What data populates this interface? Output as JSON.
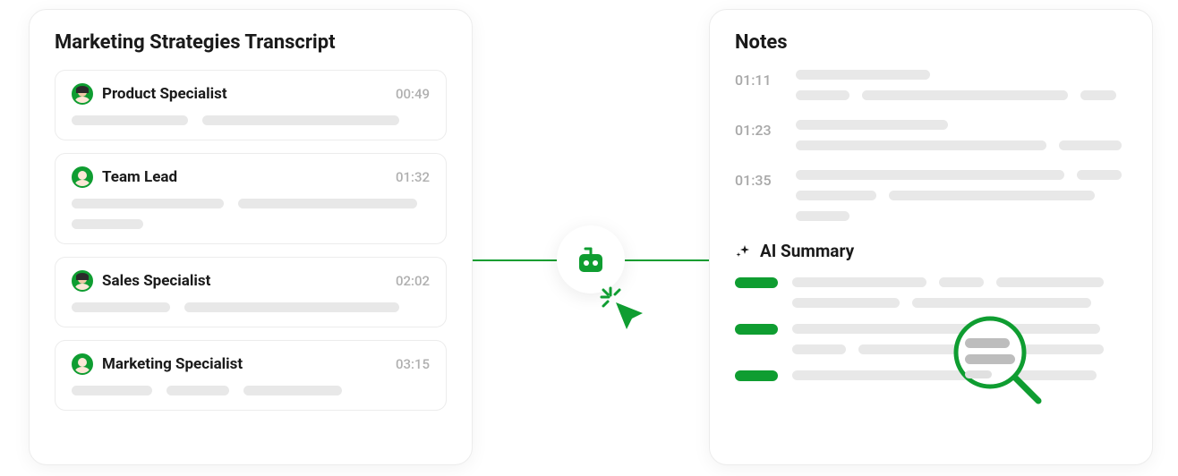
{
  "colors": {
    "accent": "#0f9d31",
    "skeleton": "#e8e8e8",
    "text_muted": "#a8a8a8"
  },
  "transcript": {
    "title": "Marketing Strategies Transcript",
    "entries": [
      {
        "role": "Product Specialist",
        "time": "00:49",
        "avatar_variant": "dark"
      },
      {
        "role": "Team Lead",
        "time": "01:32",
        "avatar_variant": "light"
      },
      {
        "role": "Sales Specialist",
        "time": "02:02",
        "avatar_variant": "dark"
      },
      {
        "role": "Marketing Specialist",
        "time": "03:15",
        "avatar_variant": "light"
      }
    ]
  },
  "connector": {
    "icon": "bot-icon",
    "cursor": "cursor-click-icon"
  },
  "notes": {
    "title": "Notes",
    "rows": [
      {
        "time": "01:11"
      },
      {
        "time": "01:23"
      },
      {
        "time": "01:35"
      }
    ],
    "ai_summary": {
      "label": "AI Summary",
      "sparkle_icon": "sparkle-icon",
      "magnifier_icon": "magnifier-icon"
    }
  }
}
